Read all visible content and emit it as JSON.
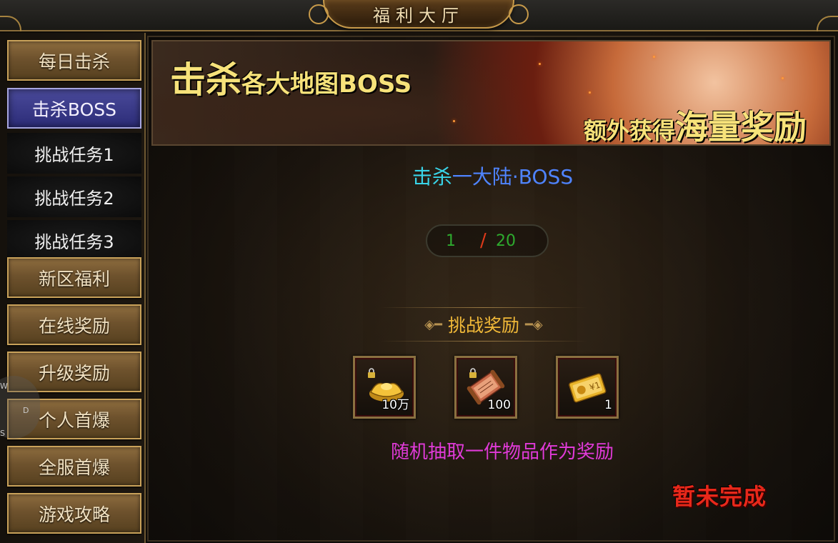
{
  "window": {
    "title": "福利大厅"
  },
  "sidebar": {
    "items": [
      {
        "label": "每日击杀",
        "state": "normal"
      },
      {
        "label": "击杀BOSS",
        "state": "active"
      },
      {
        "label": "挑战任务1",
        "state": "sub"
      },
      {
        "label": "挑战任务2",
        "state": "sub"
      },
      {
        "label": "挑战任务3",
        "state": "sub"
      },
      {
        "label": "新区福利",
        "state": "normal"
      },
      {
        "label": "在线奖励",
        "state": "normal"
      },
      {
        "label": "升级奖励",
        "state": "normal"
      },
      {
        "label": "个人首爆",
        "state": "normal"
      },
      {
        "label": "全服首爆",
        "state": "normal"
      },
      {
        "label": "游戏攻略",
        "state": "normal"
      }
    ]
  },
  "overlay": {
    "letters": [
      "W",
      "D",
      "S"
    ]
  },
  "banner": {
    "line1_big": "击杀",
    "line1_small": "各大地图BOSS",
    "line2_small": "额外获得",
    "line2_big": "海量奖励"
  },
  "main": {
    "boss_title_a": "击杀",
    "boss_title_b": "一大陆·BOSS",
    "progress": {
      "current": "1",
      "separator": "/",
      "total": "20"
    },
    "reward_header": "挑战奖励",
    "rewards": [
      {
        "icon": "gold-ingot-icon",
        "qty": "10万",
        "locked": true
      },
      {
        "icon": "scroll-icon",
        "qty": "100",
        "locked": true
      },
      {
        "icon": "gold-card-icon",
        "qty": "1",
        "locked": false
      }
    ],
    "hint": "随机抽取一件物品作为奖励",
    "status": "暂未完成"
  },
  "colors": {
    "accent_gold": "#c9a25a",
    "active_blue": "#2c2c78",
    "progress_green": "#2eaa2e",
    "hint_magenta": "#e03ad8",
    "status_red": "#e8281a"
  }
}
